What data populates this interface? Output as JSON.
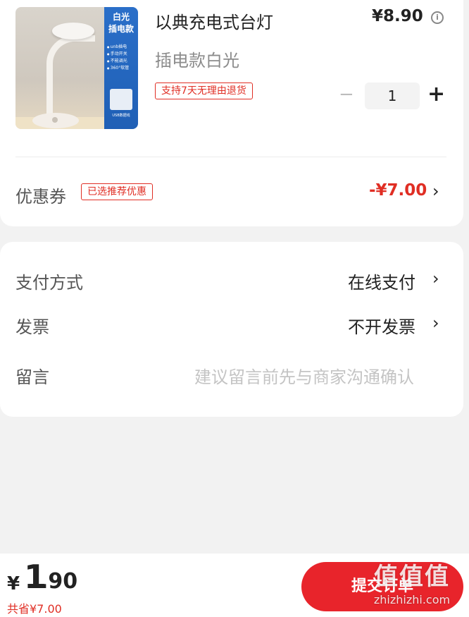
{
  "product": {
    "image_panel_title": "白光\n插电款",
    "image_features": [
      "unb插电",
      "手动开关",
      "不能调光",
      "360°软管"
    ],
    "image_usb_label": "USB数据线",
    "title": "以典充电式台灯",
    "price": "¥8.90",
    "info_icon": "info-icon",
    "variant": "插电款白光",
    "return_tag": "支持7天无理由退货",
    "qty_minus": "−",
    "quantity": "1",
    "qty_plus": "+"
  },
  "coupon": {
    "label": "优惠券",
    "tag": "已选推荐优惠",
    "value": "-¥7.00",
    "chevron": "›"
  },
  "options": {
    "payment_label": "支付方式",
    "payment_value": "在线支付",
    "invoice_label": "发票",
    "invoice_value": "不开发票",
    "message_label": "留言",
    "message_placeholder": "建议留言前先与商家沟通确认",
    "chevron": "›"
  },
  "bottom": {
    "currency": "¥",
    "total_int": "1",
    "total_dec": ".90",
    "saved": "共省¥7.00",
    "submit_label": "提交订单"
  },
  "watermark": {
    "mark": "值值值",
    "url": "zhizhizhi.com"
  },
  "colors": {
    "accent_red": "#e02e24",
    "button_red": "#e8242b",
    "background": "#f2f2f2"
  }
}
